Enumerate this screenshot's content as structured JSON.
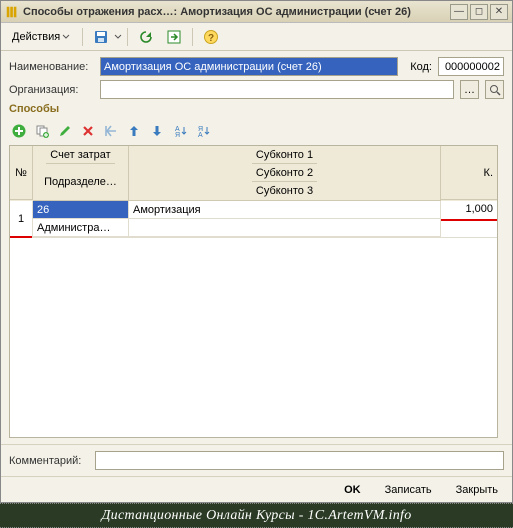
{
  "titlebar": {
    "title": "Способы отражения расх…: Амортизация ОС администрации (счет 26)"
  },
  "toolbar": {
    "actions_label": "Действия"
  },
  "form": {
    "name_label": "Наименование:",
    "name_value": "Амортизация ОС администрации (счет 26)",
    "code_label": "Код:",
    "code_value": "000000002",
    "org_label": "Организация:",
    "org_value": "",
    "section_title": "Способы",
    "comment_label": "Комментарий:",
    "comment_value": ""
  },
  "grid": {
    "headers": {
      "num": "№",
      "account": "Счет затрат",
      "division": "Подразделе…",
      "sub1": "Субконто 1",
      "sub2": "Субконто 2",
      "sub3": "Субконто 3",
      "k": "К."
    },
    "rows": [
      {
        "num": "1",
        "account": "26",
        "division": "Администра…",
        "sub1": "Амортизация",
        "k": "1,000"
      }
    ]
  },
  "footer": {
    "ok": "OK",
    "save": "Записать",
    "close": "Закрыть"
  },
  "banner": "Дистанционные Онлайн Курсы - 1C.ArtemVM.info"
}
